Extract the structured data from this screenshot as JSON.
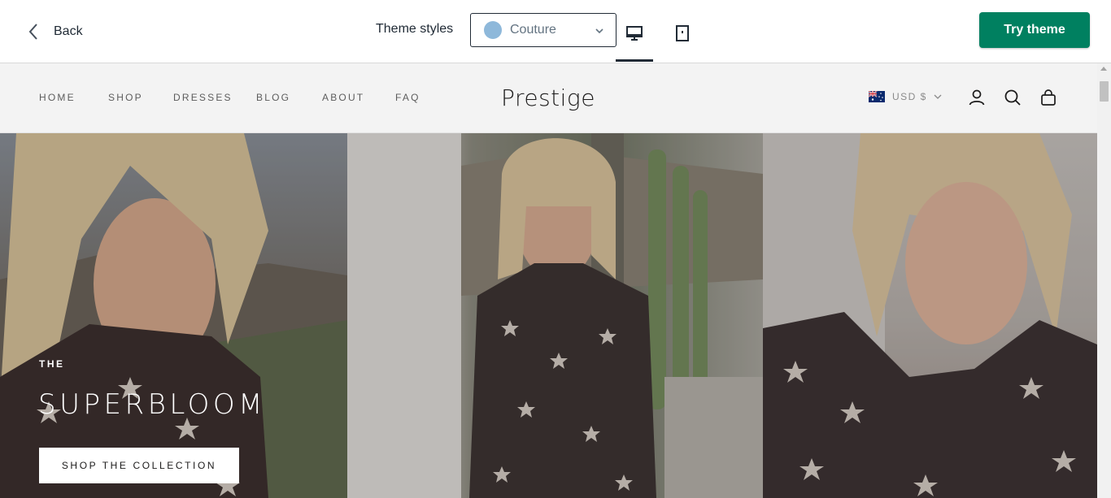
{
  "topbar": {
    "back_label": "Back",
    "theme_styles_label": "Theme styles",
    "theme_select": {
      "value": "Couture",
      "swatch_color": "#8eb8da"
    },
    "try_theme_label": "Try theme",
    "try_theme_color": "#008060",
    "active_device": "desktop"
  },
  "store": {
    "nav": [
      "HOME",
      "SHOP",
      "DRESSES",
      "BLOG",
      "ABOUT",
      "FAQ"
    ],
    "logo": "Prestige",
    "currency": "USD $",
    "header_icons": [
      "account-icon",
      "search-icon",
      "cart-icon"
    ]
  },
  "hero": {
    "kicker": "THE",
    "title": "SUPERBLOOM",
    "button_label": "SHOP THE COLLECTION"
  }
}
